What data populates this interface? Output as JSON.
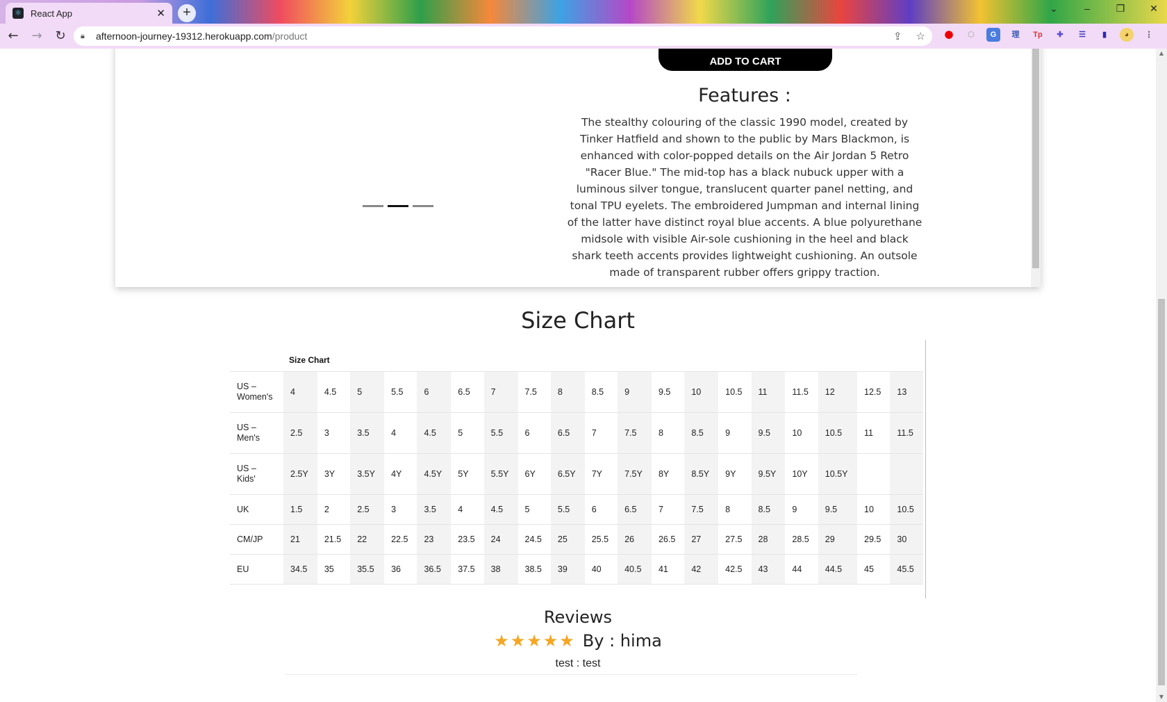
{
  "browser": {
    "tab_title": "React App",
    "url_host": "afternoon-journey-19312.herokuapp.com",
    "url_path": "/product",
    "new_tab_label": "+",
    "tab_close": "✕"
  },
  "product": {
    "add_to_cart_label": "ADD TO CART",
    "features_title": "Features :",
    "features_text": "The stealthy colouring of the classic 1990 model, created by Tinker Hatfield and shown to the public by Mars Blackmon, is enhanced with color-popped details on the Air Jordan 5 Retro \"Racer Blue.\" The mid-top has a black nubuck upper with a luminous silver tongue, translucent quarter panel netting, and tonal TPU eyelets. The embroidered Jumpman and internal lining of the latter have distinct royal blue accents. A blue polyurethane midsole with visible Air-sole cushioning in the heel and black shark teeth accents provides lightweight cushioning. An outsole made of transparent rubber offers grippy traction.",
    "carousel": {
      "slide_count": 3,
      "active_index": 1
    }
  },
  "size_chart": {
    "title": "Size Chart",
    "caption": "Size Chart",
    "rows": [
      {
        "label": "US – Women's",
        "values": [
          "4",
          "4.5",
          "5",
          "5.5",
          "6",
          "6.5",
          "7",
          "7.5",
          "8",
          "8.5",
          "9",
          "9.5",
          "10",
          "10.5",
          "11",
          "11.5",
          "12",
          "12.5",
          "13"
        ]
      },
      {
        "label": "US – Men's",
        "values": [
          "2.5",
          "3",
          "3.5",
          "4",
          "4.5",
          "5",
          "5.5",
          "6",
          "6.5",
          "7",
          "7.5",
          "8",
          "8.5",
          "9",
          "9.5",
          "10",
          "10.5",
          "11",
          "11.5"
        ]
      },
      {
        "label": "US – Kids'",
        "values": [
          "2.5Y",
          "3Y",
          "3.5Y",
          "4Y",
          "4.5Y",
          "5Y",
          "5.5Y",
          "6Y",
          "6.5Y",
          "7Y",
          "7.5Y",
          "8Y",
          "8.5Y",
          "9Y",
          "9.5Y",
          "10Y",
          "10.5Y",
          "",
          ""
        ]
      },
      {
        "label": "UK",
        "values": [
          "1.5",
          "2",
          "2.5",
          "3",
          "3.5",
          "4",
          "4.5",
          "5",
          "5.5",
          "6",
          "6.5",
          "7",
          "7.5",
          "8",
          "8.5",
          "9",
          "9.5",
          "10",
          "10.5"
        ]
      },
      {
        "label": "CM/JP",
        "values": [
          "21",
          "21.5",
          "22",
          "22.5",
          "23",
          "23.5",
          "24",
          "24.5",
          "25",
          "25.5",
          "26",
          "26.5",
          "27",
          "27.5",
          "28",
          "28.5",
          "29",
          "29.5",
          "30"
        ]
      },
      {
        "label": "EU",
        "values": [
          "34.5",
          "35",
          "35.5",
          "36",
          "36.5",
          "37.5",
          "38",
          "38.5",
          "39",
          "40",
          "40.5",
          "41",
          "42",
          "42.5",
          "43",
          "44",
          "44.5",
          "45",
          "45.5"
        ]
      }
    ]
  },
  "reviews": {
    "title": "Reviews",
    "items": [
      {
        "rating": 5,
        "by": "By : hima",
        "text": "test : test"
      }
    ]
  },
  "colors": {
    "accent_star": "#f5a623",
    "button_bg": "#000000"
  }
}
